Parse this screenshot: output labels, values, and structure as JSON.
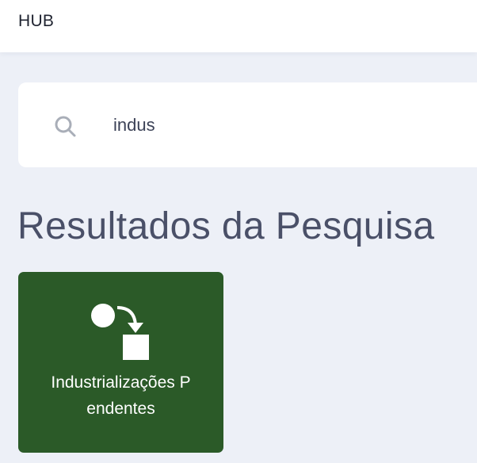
{
  "header": {
    "brand": "HUB"
  },
  "search": {
    "value": "indus",
    "icon": "search-icon"
  },
  "results": {
    "title": "Resultados da Pesquisa",
    "items": [
      {
        "label": "Industrializações Pendentes",
        "icon": "pending-industrialization-icon",
        "color": "#2b5a28"
      }
    ]
  },
  "colors": {
    "background": "#edf0f7",
    "card": "#2b5a28"
  }
}
